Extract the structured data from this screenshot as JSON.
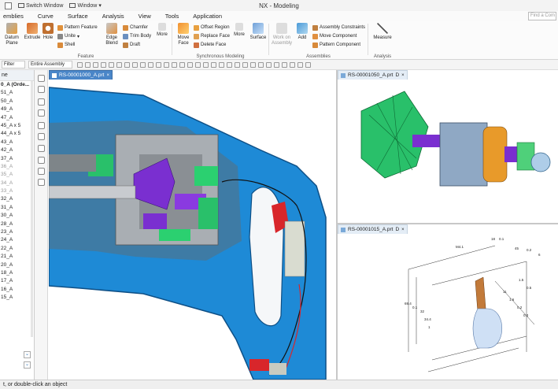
{
  "titlebar": {
    "switch_window": "Switch Window",
    "window": "Window",
    "app_title": "NX - Modeling"
  },
  "menu": {
    "items": [
      "emblies",
      "Curve",
      "Surface",
      "Analysis",
      "View",
      "Tools",
      "Application"
    ],
    "find_command_placeholder": "Find a Com"
  },
  "ribbon": {
    "feature_group_label": "Feature",
    "sync_group_label": "Synchronous Modeling",
    "assemblies_group_label": "Assemblies",
    "analysis_group_label": "Analysis",
    "datum_plane": "Datum Plane",
    "extrude": "Extrude",
    "hole": "Hole",
    "pattern_feature": "Pattern Feature",
    "unite": "Unite",
    "shell": "Shell",
    "edge_blend": "Edge Blend",
    "chamfer": "Chamfer",
    "trim_body": "Trim Body",
    "draft": "Draft",
    "more_1": "More",
    "move_face": "Move Face",
    "offset_region": "Offset Region",
    "replace_face": "Replace Face",
    "delete_face": "Delete Face",
    "more_2": "More",
    "surface": "Surface",
    "work_on_assembly": "Work on Assembly",
    "add": "Add",
    "assembly_constraints": "Assembly Constraints",
    "move_component": "Move Component",
    "pattern_component": "Pattern Component",
    "measure": "Measure"
  },
  "filterbar": {
    "filter_label": "Filter",
    "scope_value": "Entire Assembly"
  },
  "navigator": {
    "header": "ne",
    "root": "0_A (Orde...",
    "items": [
      "51_A",
      "50_A",
      "49_A",
      "47_A",
      "45_A x 5",
      "44_A x 5",
      "43_A",
      "42_A",
      "37_A",
      "36_A",
      "35_A",
      "34_A",
      "33_A",
      "32_A",
      "31_A",
      "30_A",
      "28_A",
      "23_A",
      "24_A",
      "22_A",
      "21_A",
      "20_A",
      "18_A",
      "17_A",
      "16_A",
      "15_A"
    ],
    "grey_items": [
      9,
      10,
      11,
      12
    ]
  },
  "viewports": {
    "main_tab": "RS-00001000_A.prt",
    "top_right_tab": "RS-00001050_A.prt",
    "bottom_right_tab": "RS-00001015_A.prt",
    "tab_suffix": "D",
    "close": "×"
  },
  "drawing_dims": [
    "M4.1",
    "18",
    "0.1",
    "45",
    "0.2",
    "6",
    "1.5",
    "0.5",
    "69.4",
    "0.1",
    "32",
    "34.4",
    "1",
    "11",
    "1.6",
    "0.2",
    "0.3"
  ],
  "statusbar": {
    "text": "t, or double-click an object"
  },
  "colors": {
    "tab_active": "#4a86c8",
    "drill_blue": "#1e8ad6",
    "gear_green": "#29c06a",
    "gear_purple": "#7a2fd0",
    "trigger_red": "#d8262b"
  }
}
